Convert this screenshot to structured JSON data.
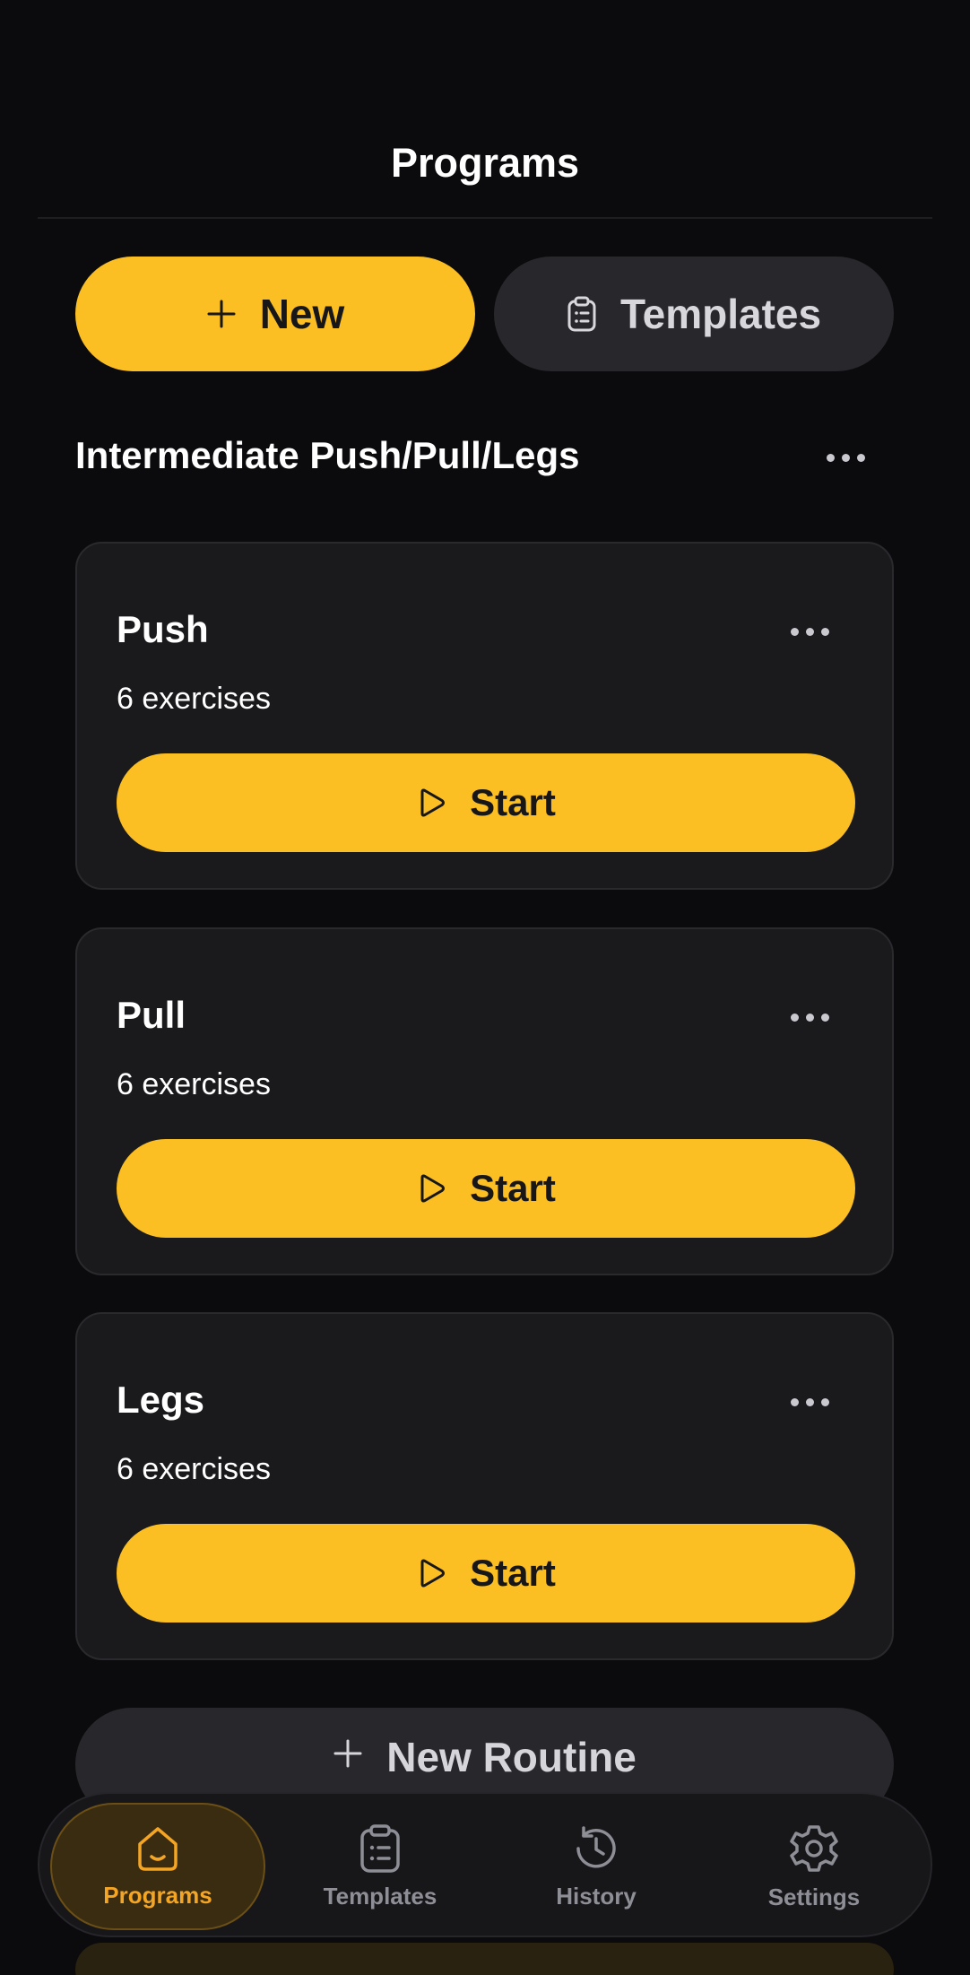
{
  "header": {
    "title": "Programs"
  },
  "actions": {
    "new_label": "New",
    "templates_label": "Templates"
  },
  "program": {
    "title": "Intermediate Push/Pull/Legs"
  },
  "routines": [
    {
      "name": "Push",
      "subtitle": "6 exercises",
      "start_label": "Start"
    },
    {
      "name": "Pull",
      "subtitle": "6 exercises",
      "start_label": "Start"
    },
    {
      "name": "Legs",
      "subtitle": "6 exercises",
      "start_label": "Start"
    }
  ],
  "new_routine_label": "New Routine",
  "nav": {
    "items": [
      {
        "label": "Programs",
        "icon": "home-icon",
        "active": true
      },
      {
        "label": "Templates",
        "icon": "clipboard-icon",
        "active": false
      },
      {
        "label": "History",
        "icon": "history-icon",
        "active": false
      },
      {
        "label": "Settings",
        "icon": "gear-icon",
        "active": false
      }
    ]
  },
  "colors": {
    "accent": "#fbbf24",
    "background": "#0b0b0d",
    "card": "#1a1a1d",
    "nav_active": "#f5a524"
  }
}
